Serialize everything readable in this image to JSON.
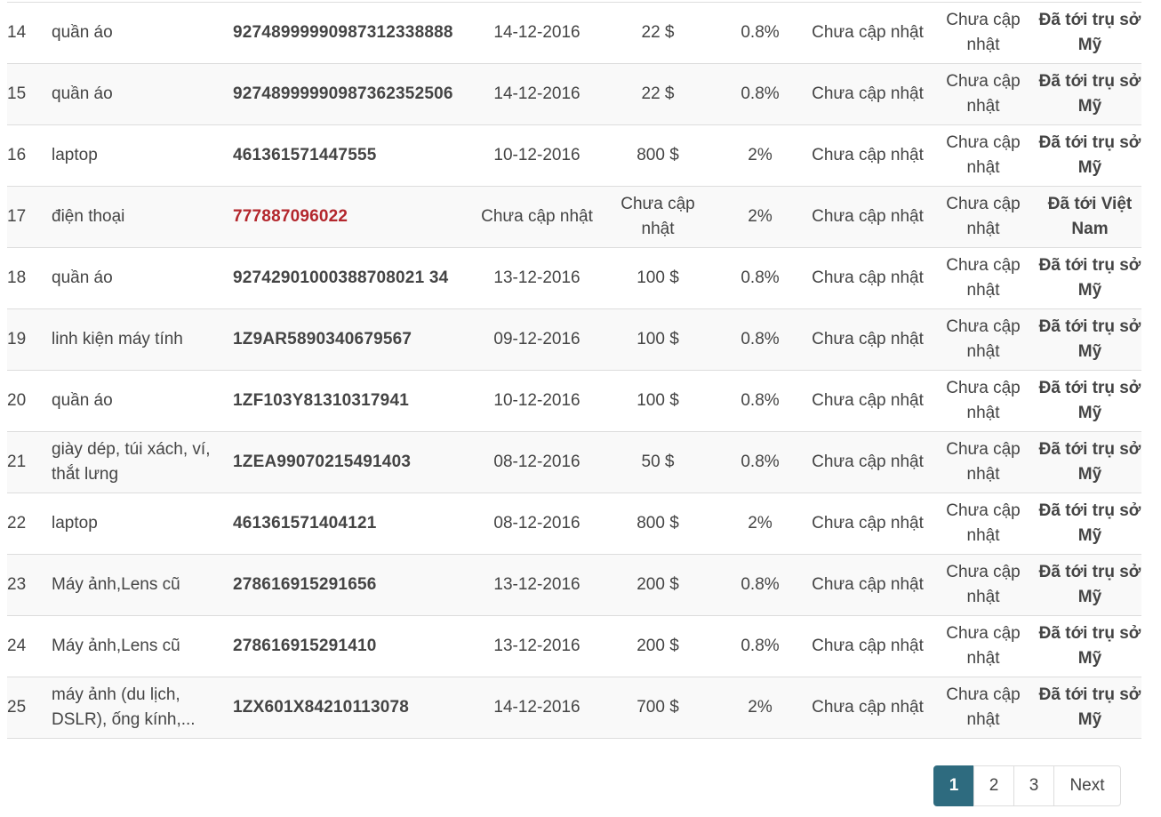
{
  "rows": [
    {
      "no": "14",
      "name": "quần áo",
      "tracking": "92748999990987312338888",
      "date": "14-12-2016",
      "price": "22 $",
      "fee": "0.8%",
      "update1": "Chưa cập nhật",
      "update2": "Chưa cập nhật",
      "status": "Đã tới trụ sở Mỹ"
    },
    {
      "no": "15",
      "name": "quần áo",
      "tracking": "92748999990987362352506",
      "date": "14-12-2016",
      "price": "22 $",
      "fee": "0.8%",
      "update1": "Chưa cập nhật",
      "update2": "Chưa cập nhật",
      "status": "Đã tới trụ sở Mỹ"
    },
    {
      "no": "16",
      "name": "laptop",
      "tracking": "461361571447555",
      "date": "10-12-2016",
      "price": "800 $",
      "fee": "2%",
      "update1": "Chưa cập nhật",
      "update2": "Chưa cập nhật",
      "status": "Đã tới trụ sở Mỹ"
    },
    {
      "no": "17",
      "name": "điện thoại",
      "tracking": "777887096022",
      "date": "Chưa cập nhật",
      "price": "Chưa cập nhật",
      "fee": "2%",
      "update1": "Chưa cập nhật",
      "update2": "Chưa cập nhật",
      "status": "Đã tới Việt Nam"
    },
    {
      "no": "18",
      "name": "quần áo",
      "tracking": "92742901000388708021 34",
      "date": "13-12-2016",
      "price": "100 $",
      "fee": "0.8%",
      "update1": "Chưa cập nhật",
      "update2": "Chưa cập nhật",
      "status": "Đã tới trụ sở Mỹ"
    },
    {
      "no": "19",
      "name": "linh kiện máy tính",
      "tracking": "1Z9AR5890340679567",
      "date": "09-12-2016",
      "price": "100 $",
      "fee": "0.8%",
      "update1": "Chưa cập nhật",
      "update2": "Chưa cập nhật",
      "status": "Đã tới trụ sở Mỹ"
    },
    {
      "no": "20",
      "name": "quần áo",
      "tracking": "1ZF103Y81310317941",
      "date": "10-12-2016",
      "price": "100 $",
      "fee": "0.8%",
      "update1": "Chưa cập nhật",
      "update2": "Chưa cập nhật",
      "status": "Đã tới trụ sở Mỹ"
    },
    {
      "no": "21",
      "name": "giày dép, túi xách, ví, thắt lưng",
      "tracking": "1ZEA99070215491403",
      "date": "08-12-2016",
      "price": "50 $",
      "fee": "0.8%",
      "update1": "Chưa cập nhật",
      "update2": "Chưa cập nhật",
      "status": "Đã tới trụ sở Mỹ"
    },
    {
      "no": "22",
      "name": "laptop",
      "tracking": "461361571404121",
      "date": "08-12-2016",
      "price": "800 $",
      "fee": "2%",
      "update1": "Chưa cập nhật",
      "update2": "Chưa cập nhật",
      "status": "Đã tới trụ sở Mỹ"
    },
    {
      "no": "23",
      "name": "Máy ảnh,Lens cũ",
      "tracking": "278616915291656",
      "date": "13-12-2016",
      "price": "200 $",
      "fee": "0.8%",
      "update1": "Chưa cập nhật",
      "update2": "Chưa cập nhật",
      "status": "Đã tới trụ sở Mỹ"
    },
    {
      "no": "24",
      "name": "Máy ảnh,Lens cũ",
      "tracking": "278616915291410",
      "date": "13-12-2016",
      "price": "200 $",
      "fee": "0.8%",
      "update1": "Chưa cập nhật",
      "update2": "Chưa cập nhật",
      "status": "Đã tới trụ sở Mỹ"
    },
    {
      "no": "25",
      "name": "máy ảnh (du lịch, DSLR), ống kính,...",
      "tracking": "1ZX601X84210113078",
      "date": "14-12-2016",
      "price": "700 $",
      "fee": "2%",
      "update1": "Chưa cập nhật",
      "update2": "Chưa cập nhật",
      "status": "Đã tới trụ sở Mỹ"
    }
  ],
  "pagination": {
    "pages": [
      "1",
      "2",
      "3"
    ],
    "active": "1",
    "next_label": "Next"
  },
  "colors": {
    "highlight_tracking": "#b3272d",
    "pager_active": "#2e6b7f"
  }
}
